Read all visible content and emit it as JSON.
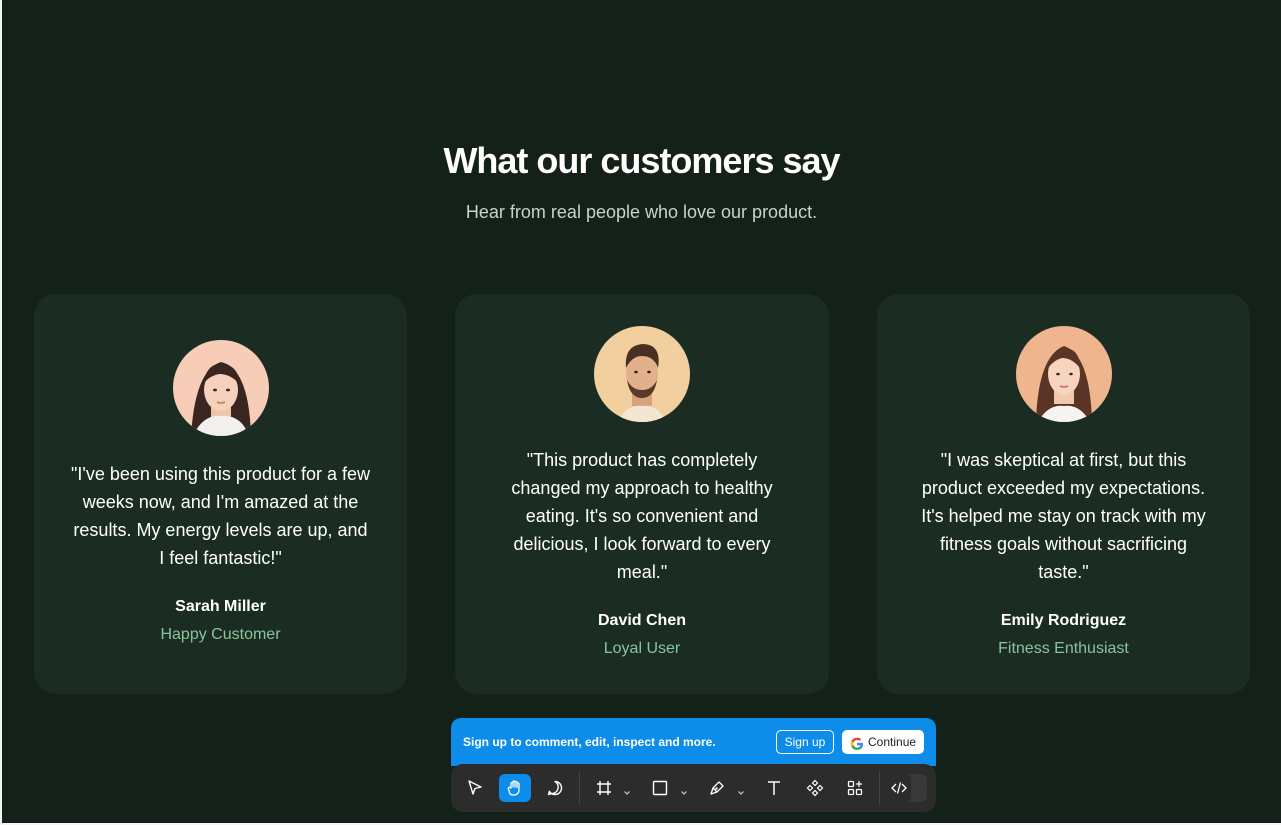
{
  "section": {
    "title": "What our customers say",
    "subtitle": "Hear from real people who love our product."
  },
  "testimonials": [
    {
      "quote": "\"I've been using this product for a few weeks now, and I'm amazed at the results. My energy levels are up, and I feel fantastic!\"",
      "name": "Sarah Miller",
      "role": "Happy Customer"
    },
    {
      "quote": "\"This product has completely changed my approach to healthy eating. It's so convenient and delicious, I look forward to every meal.\"",
      "name": "David Chen",
      "role": "Loyal User"
    },
    {
      "quote": "\"I was skeptical at first, but this product exceeded my expectations. It's helped me stay on track with my fitness goals without sacrificing taste.\"",
      "name": "Emily Rodriguez",
      "role": "Fitness Enthusiast"
    }
  ],
  "banner": {
    "text": "Sign up to comment, edit, inspect and more.",
    "signup_label": "Sign up",
    "continue_label": "Continue"
  },
  "toolbar": {
    "tools": [
      "move-icon",
      "hand-icon",
      "comment-icon",
      "frame-icon",
      "rectangle-icon",
      "pen-icon",
      "text-icon",
      "component-icon",
      "actions-icon",
      "code-icon"
    ],
    "active_tool": "hand-icon"
  },
  "colors": {
    "background": "#132118",
    "card": "#1b2d23",
    "role_accent": "#86c59b",
    "banner": "#0d8ce9",
    "toolbar": "#2c2c2c"
  }
}
